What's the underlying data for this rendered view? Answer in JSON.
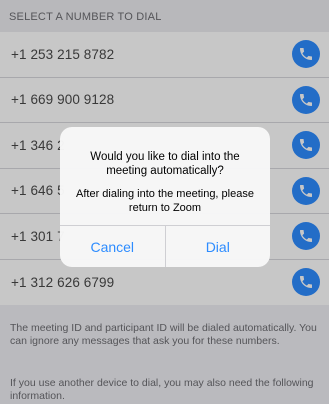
{
  "header": {
    "title": "SELECT A NUMBER TO DIAL"
  },
  "numbers": [
    {
      "label": "+1 253 215 8782"
    },
    {
      "label": "+1 669 900 9128"
    },
    {
      "label": "+1 346 2"
    },
    {
      "label": "+1 646 5"
    },
    {
      "label": "+1 301 7"
    },
    {
      "label": "+1 312 626 6799"
    }
  ],
  "notes": {
    "primary": "The meeting ID and participant ID will be dialed automatically. You can ignore any messages that ask you for these numbers.",
    "secondary": "If you use another device to dial, you may also need the following information."
  },
  "dialog": {
    "title": "Would you like to dial into the meeting automatically?",
    "message": "After dialing into the meeting, please return to Zoom",
    "cancel_label": "Cancel",
    "dial_label": "Dial"
  },
  "colors": {
    "accent": "#2d8cff",
    "background": "#efeff4"
  },
  "icons": {
    "call_button": "phone-icon"
  }
}
